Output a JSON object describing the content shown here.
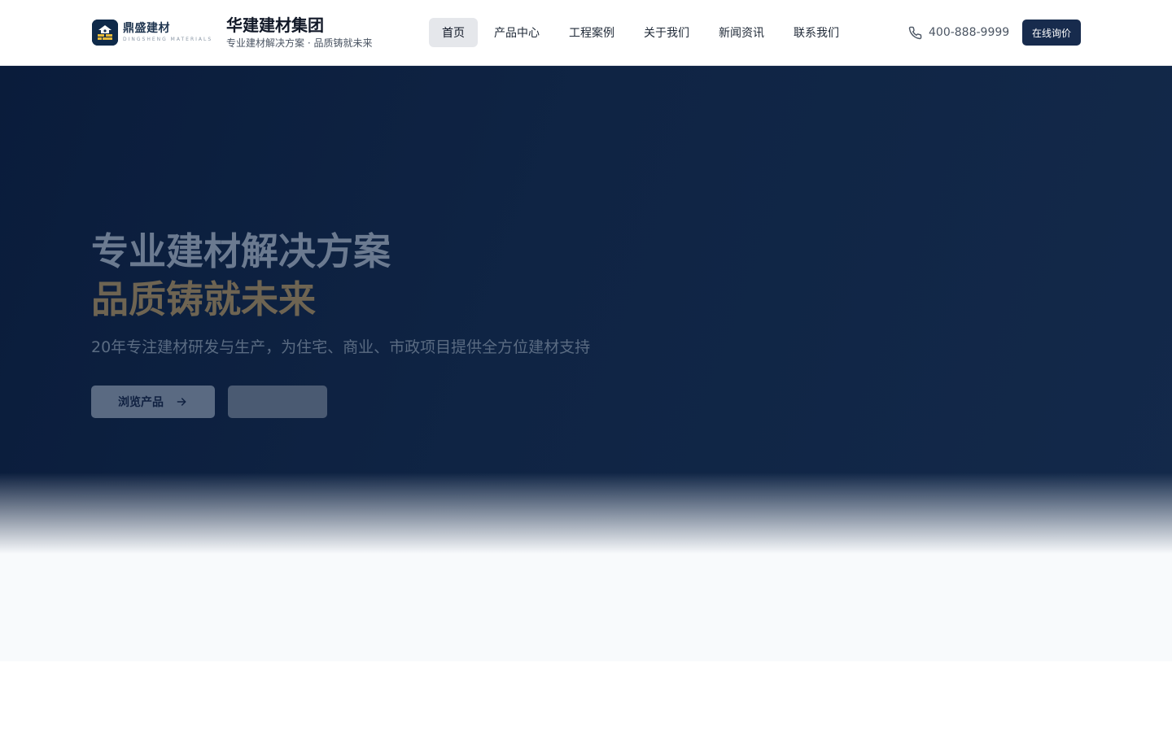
{
  "header": {
    "logo": {
      "cn": "鼎盛建材",
      "en": "DINGSHENG MATERIALS"
    },
    "brand_title": "华建建材集团",
    "brand_subtitle": "专业建材解决方案 · 品质铸就未来",
    "nav": [
      {
        "label": "首页",
        "active": true
      },
      {
        "label": "产品中心",
        "active": false
      },
      {
        "label": "工程案例",
        "active": false
      },
      {
        "label": "关于我们",
        "active": false
      },
      {
        "label": "新闻资讯",
        "active": false
      },
      {
        "label": "联系我们",
        "active": false
      }
    ],
    "phone": "400-888-9999",
    "cta_label": "在线询价"
  },
  "hero": {
    "title_line1": "专业建材解决方案",
    "title_line2": "品质铸就未来",
    "description": "20年专注建材研发与生产，为住宅、商业、市政项目提供全方位建材支持",
    "primary_button": "浏览产品",
    "secondary_button": ""
  },
  "colors": {
    "navy": "#172b4d",
    "hero_bg": "#0f2444",
    "accent_gold": "#6e6452"
  },
  "icons": [
    "phone-icon",
    "arrow-right-icon",
    "logo-icon"
  ]
}
